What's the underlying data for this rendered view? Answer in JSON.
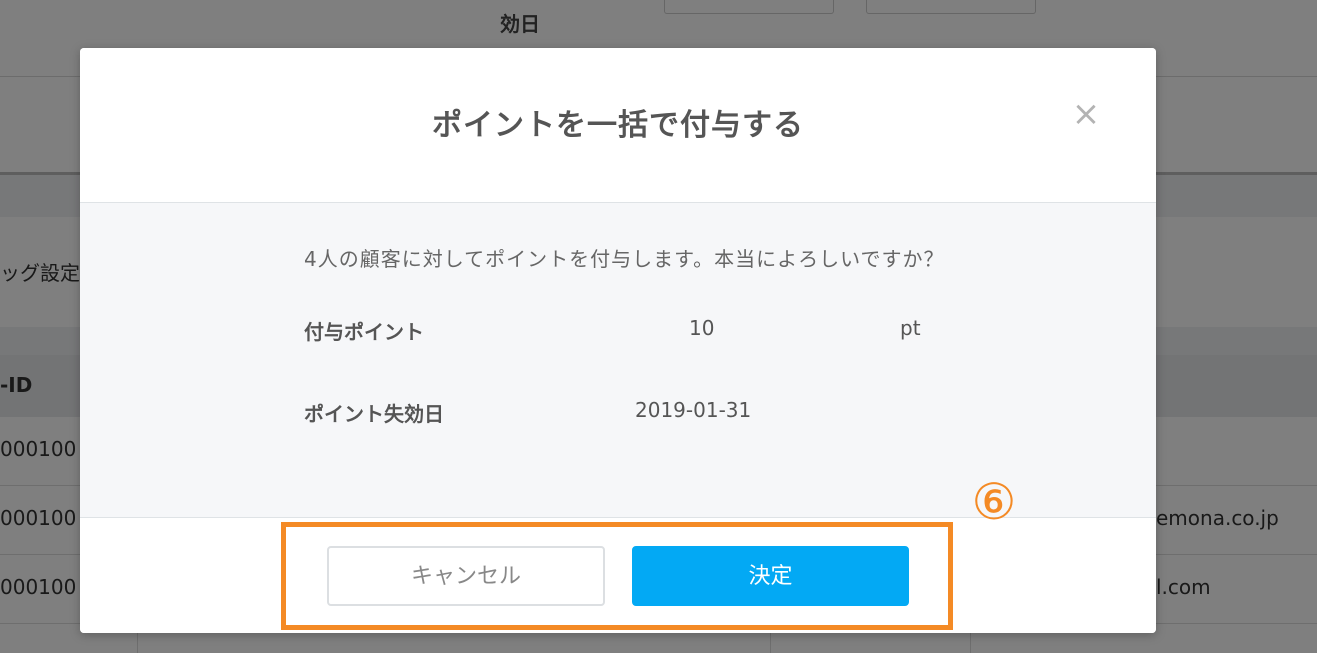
{
  "background": {
    "header_label": "効日",
    "tag_settings_label": "ッグ設定",
    "id_header": "-ID",
    "rows": [
      {
        "id": "000100",
        "email": ""
      },
      {
        "id": "000100",
        "email": "emona.co.jp"
      },
      {
        "id": "000100",
        "email": "l.com"
      }
    ]
  },
  "modal": {
    "title": "ポイントを一括で付与する",
    "close_glyph": "×",
    "message": "4人の顧客に対してポイントを付与します。本当によろしいですか？",
    "points_label": "付与ポイント",
    "points_value": "10",
    "points_unit": "pt",
    "expiry_label": "ポイント失効日",
    "expiry_value": "2019-01-31",
    "cancel_label": "キャンセル",
    "confirm_label": "決定"
  },
  "annotation": {
    "step_label": "⑥"
  },
  "colors": {
    "primary": "#03a9f4",
    "annotation": "#f48a25",
    "overlay": "rgba(0,0,0,0.5)"
  }
}
